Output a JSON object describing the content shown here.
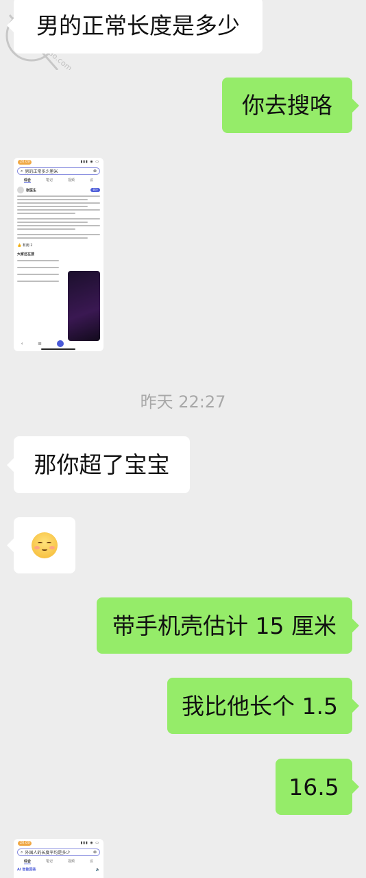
{
  "messages": [
    {
      "side": "left",
      "text": "男的正常长度是多少"
    },
    {
      "side": "right",
      "text": "你去搜咯"
    },
    {
      "side": "left",
      "text": "那你超了宝宝"
    },
    {
      "side": "left",
      "emoji": "smiling-face-with-blush"
    },
    {
      "side": "right",
      "text": "带手机壳估计 15 厘米"
    },
    {
      "side": "right",
      "text": "我比他长个 1.5"
    },
    {
      "side": "right",
      "text": "16.5"
    }
  ],
  "timestamp": "昨天 22:27",
  "watermark": {
    "text": "haijiao.com"
  },
  "thumbnail1": {
    "time": "20:09",
    "sys_icons": "▮▮▮ ◉ ▭",
    "query": "男的正常多少厘米",
    "tabs": [
      "综合",
      "笔记",
      "视频",
      "议"
    ],
    "author": "张医生",
    "follow": "关注",
    "like_count": "有用 2",
    "section_title": "大家还在搜"
  },
  "thumbnail2": {
    "time": "20:09",
    "sys_icons": "▮▮▮ ◉ ▭",
    "query": "外国人的长度平均是多少",
    "tabs": [
      "综合",
      "笔记",
      "视频",
      "议"
    ],
    "ai_label": "AI 智能回答"
  },
  "colors": {
    "background": "#ededed",
    "left_bubble": "#ffffff",
    "right_bubble": "#95ec69",
    "timestamp": "#a8a8a8"
  }
}
